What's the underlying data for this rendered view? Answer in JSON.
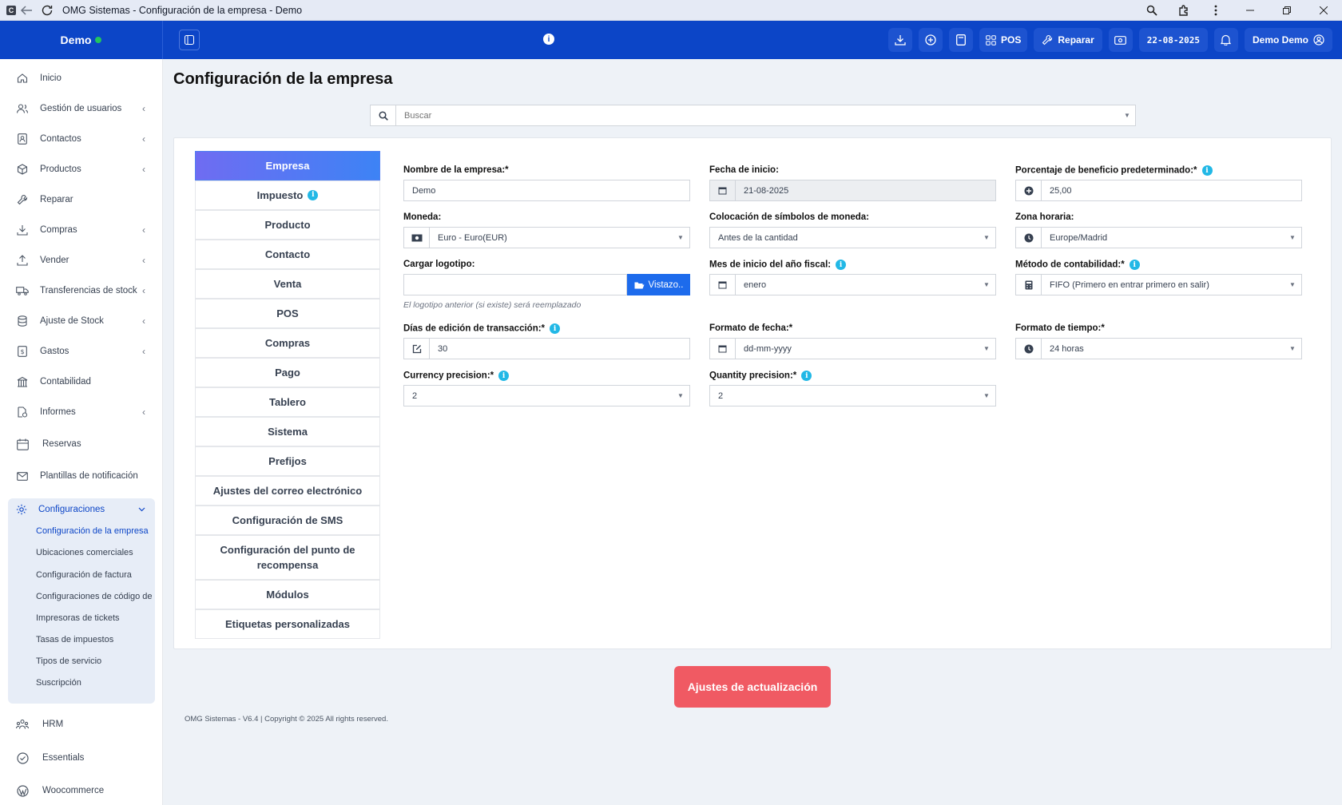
{
  "window": {
    "title": "OMG Sistemas - Configuración de la empresa - Demo",
    "app_icon": "C"
  },
  "topnav": {
    "brand": "Demo",
    "pos_label": "POS",
    "repair_label": "Reparar",
    "date": "22-08-2025",
    "user": "Demo Demo"
  },
  "sidebar": {
    "items": [
      {
        "label": "Inicio"
      },
      {
        "label": "Gestión de usuarios"
      },
      {
        "label": "Contactos"
      },
      {
        "label": "Productos"
      },
      {
        "label": "Reparar"
      },
      {
        "label": "Compras"
      },
      {
        "label": "Vender"
      },
      {
        "label": "Transferencias de stock"
      },
      {
        "label": "Ajuste de Stock"
      },
      {
        "label": "Gastos"
      },
      {
        "label": "Contabilidad"
      },
      {
        "label": "Informes"
      },
      {
        "label": "Reservas"
      },
      {
        "label": "Plantillas de notificación"
      }
    ],
    "config": {
      "label": "Configuraciones",
      "subitems": [
        {
          "label": "Configuración de la empresa"
        },
        {
          "label": "Ubicaciones comerciales"
        },
        {
          "label": "Configuración de factura"
        },
        {
          "label": "Configuraciones de código de barras"
        },
        {
          "label": "Impresoras de tickets"
        },
        {
          "label": "Tasas de impuestos"
        },
        {
          "label": "Tipos de servicio"
        },
        {
          "label": "Suscripción"
        }
      ]
    },
    "bottom": [
      {
        "label": "HRM"
      },
      {
        "label": "Essentials"
      },
      {
        "label": "Woocommerce"
      }
    ]
  },
  "main": {
    "title": "Configuración de la empresa",
    "search_placeholder": "Buscar",
    "tabs": [
      "Empresa",
      "Impuesto",
      "Producto",
      "Contacto",
      "Venta",
      "POS",
      "Compras",
      "Pago",
      "Tablero",
      "Sistema",
      "Prefijos",
      "Ajustes del correo electrónico",
      "Configuración de SMS",
      "Configuración del punto de recompensa",
      "Módulos",
      "Etiquetas personalizadas"
    ],
    "fields": {
      "business_name": {
        "label": "Nombre de la empresa:*",
        "value": "Demo"
      },
      "start_date": {
        "label": "Fecha de inicio:",
        "value": "21-08-2025"
      },
      "profit_percent": {
        "label": "Porcentaje de beneficio predeterminado:*",
        "value": "25,00"
      },
      "currency": {
        "label": "Moneda:",
        "value": "Euro - Euro(EUR)"
      },
      "currency_symbol": {
        "label": "Colocación de símbolos de moneda:",
        "value": "Antes de la cantidad"
      },
      "timezone": {
        "label": "Zona horaria:",
        "value": "Europe/Madrid"
      },
      "logo": {
        "label": "Cargar logotipo:",
        "button": "Vistazo..",
        "hint": "El logotipo anterior (si existe) será reemplazado"
      },
      "fiscal_month": {
        "label": "Mes de inicio del año fiscal:",
        "value": "enero"
      },
      "accounting": {
        "label": "Método de contabilidad:*",
        "value": "FIFO (Primero en entrar primero en salir)"
      },
      "edit_days": {
        "label": "Días de edición de transacción:*",
        "value": "30"
      },
      "date_format": {
        "label": "Formato de fecha:*",
        "value": "dd-mm-yyyy"
      },
      "time_format": {
        "label": "Formato de tiempo:*",
        "value": "24 horas"
      },
      "currency_precision": {
        "label": "Currency precision:*",
        "value": "2"
      },
      "quantity_precision": {
        "label": "Quantity precision:*",
        "value": "2"
      }
    },
    "update_button": "Ajustes de actualización",
    "footer": "OMG Sistemas - V6.4 | Copyright © 2025 All rights reserved."
  },
  "colors": {
    "nav_blue": "#0c45c7",
    "active_tab": "#4f7ff2",
    "update_button": "#f05a63",
    "info_icon": "#22b8e6"
  }
}
